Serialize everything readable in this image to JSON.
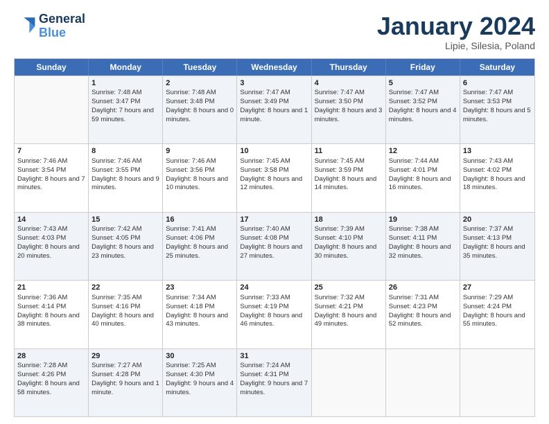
{
  "header": {
    "logo_line1": "General",
    "logo_line2": "Blue",
    "month": "January 2024",
    "location": "Lipie, Silesia, Poland"
  },
  "days": [
    "Sunday",
    "Monday",
    "Tuesday",
    "Wednesday",
    "Thursday",
    "Friday",
    "Saturday"
  ],
  "rows": [
    [
      {
        "day": "",
        "empty": true
      },
      {
        "day": "1",
        "sunrise": "Sunrise: 7:48 AM",
        "sunset": "Sunset: 3:47 PM",
        "daylight": "Daylight: 7 hours and 59 minutes."
      },
      {
        "day": "2",
        "sunrise": "Sunrise: 7:48 AM",
        "sunset": "Sunset: 3:48 PM",
        "daylight": "Daylight: 8 hours and 0 minutes."
      },
      {
        "day": "3",
        "sunrise": "Sunrise: 7:47 AM",
        "sunset": "Sunset: 3:49 PM",
        "daylight": "Daylight: 8 hours and 1 minute."
      },
      {
        "day": "4",
        "sunrise": "Sunrise: 7:47 AM",
        "sunset": "Sunset: 3:50 PM",
        "daylight": "Daylight: 8 hours and 3 minutes."
      },
      {
        "day": "5",
        "sunrise": "Sunrise: 7:47 AM",
        "sunset": "Sunset: 3:52 PM",
        "daylight": "Daylight: 8 hours and 4 minutes."
      },
      {
        "day": "6",
        "sunrise": "Sunrise: 7:47 AM",
        "sunset": "Sunset: 3:53 PM",
        "daylight": "Daylight: 8 hours and 5 minutes."
      }
    ],
    [
      {
        "day": "7",
        "sunrise": "Sunrise: 7:46 AM",
        "sunset": "Sunset: 3:54 PM",
        "daylight": "Daylight: 8 hours and 7 minutes."
      },
      {
        "day": "8",
        "sunrise": "Sunrise: 7:46 AM",
        "sunset": "Sunset: 3:55 PM",
        "daylight": "Daylight: 8 hours and 9 minutes."
      },
      {
        "day": "9",
        "sunrise": "Sunrise: 7:46 AM",
        "sunset": "Sunset: 3:56 PM",
        "daylight": "Daylight: 8 hours and 10 minutes."
      },
      {
        "day": "10",
        "sunrise": "Sunrise: 7:45 AM",
        "sunset": "Sunset: 3:58 PM",
        "daylight": "Daylight: 8 hours and 12 minutes."
      },
      {
        "day": "11",
        "sunrise": "Sunrise: 7:45 AM",
        "sunset": "Sunset: 3:59 PM",
        "daylight": "Daylight: 8 hours and 14 minutes."
      },
      {
        "day": "12",
        "sunrise": "Sunrise: 7:44 AM",
        "sunset": "Sunset: 4:01 PM",
        "daylight": "Daylight: 8 hours and 16 minutes."
      },
      {
        "day": "13",
        "sunrise": "Sunrise: 7:43 AM",
        "sunset": "Sunset: 4:02 PM",
        "daylight": "Daylight: 8 hours and 18 minutes."
      }
    ],
    [
      {
        "day": "14",
        "sunrise": "Sunrise: 7:43 AM",
        "sunset": "Sunset: 4:03 PM",
        "daylight": "Daylight: 8 hours and 20 minutes."
      },
      {
        "day": "15",
        "sunrise": "Sunrise: 7:42 AM",
        "sunset": "Sunset: 4:05 PM",
        "daylight": "Daylight: 8 hours and 23 minutes."
      },
      {
        "day": "16",
        "sunrise": "Sunrise: 7:41 AM",
        "sunset": "Sunset: 4:06 PM",
        "daylight": "Daylight: 8 hours and 25 minutes."
      },
      {
        "day": "17",
        "sunrise": "Sunrise: 7:40 AM",
        "sunset": "Sunset: 4:08 PM",
        "daylight": "Daylight: 8 hours and 27 minutes."
      },
      {
        "day": "18",
        "sunrise": "Sunrise: 7:39 AM",
        "sunset": "Sunset: 4:10 PM",
        "daylight": "Daylight: 8 hours and 30 minutes."
      },
      {
        "day": "19",
        "sunrise": "Sunrise: 7:38 AM",
        "sunset": "Sunset: 4:11 PM",
        "daylight": "Daylight: 8 hours and 32 minutes."
      },
      {
        "day": "20",
        "sunrise": "Sunrise: 7:37 AM",
        "sunset": "Sunset: 4:13 PM",
        "daylight": "Daylight: 8 hours and 35 minutes."
      }
    ],
    [
      {
        "day": "21",
        "sunrise": "Sunrise: 7:36 AM",
        "sunset": "Sunset: 4:14 PM",
        "daylight": "Daylight: 8 hours and 38 minutes."
      },
      {
        "day": "22",
        "sunrise": "Sunrise: 7:35 AM",
        "sunset": "Sunset: 4:16 PM",
        "daylight": "Daylight: 8 hours and 40 minutes."
      },
      {
        "day": "23",
        "sunrise": "Sunrise: 7:34 AM",
        "sunset": "Sunset: 4:18 PM",
        "daylight": "Daylight: 8 hours and 43 minutes."
      },
      {
        "day": "24",
        "sunrise": "Sunrise: 7:33 AM",
        "sunset": "Sunset: 4:19 PM",
        "daylight": "Daylight: 8 hours and 46 minutes."
      },
      {
        "day": "25",
        "sunrise": "Sunrise: 7:32 AM",
        "sunset": "Sunset: 4:21 PM",
        "daylight": "Daylight: 8 hours and 49 minutes."
      },
      {
        "day": "26",
        "sunrise": "Sunrise: 7:31 AM",
        "sunset": "Sunset: 4:23 PM",
        "daylight": "Daylight: 8 hours and 52 minutes."
      },
      {
        "day": "27",
        "sunrise": "Sunrise: 7:29 AM",
        "sunset": "Sunset: 4:24 PM",
        "daylight": "Daylight: 8 hours and 55 minutes."
      }
    ],
    [
      {
        "day": "28",
        "sunrise": "Sunrise: 7:28 AM",
        "sunset": "Sunset: 4:26 PM",
        "daylight": "Daylight: 8 hours and 58 minutes."
      },
      {
        "day": "29",
        "sunrise": "Sunrise: 7:27 AM",
        "sunset": "Sunset: 4:28 PM",
        "daylight": "Daylight: 9 hours and 1 minute."
      },
      {
        "day": "30",
        "sunrise": "Sunrise: 7:25 AM",
        "sunset": "Sunset: 4:30 PM",
        "daylight": "Daylight: 9 hours and 4 minutes."
      },
      {
        "day": "31",
        "sunrise": "Sunrise: 7:24 AM",
        "sunset": "Sunset: 4:31 PM",
        "daylight": "Daylight: 9 hours and 7 minutes."
      },
      {
        "day": "",
        "empty": true
      },
      {
        "day": "",
        "empty": true
      },
      {
        "day": "",
        "empty": true
      }
    ]
  ]
}
